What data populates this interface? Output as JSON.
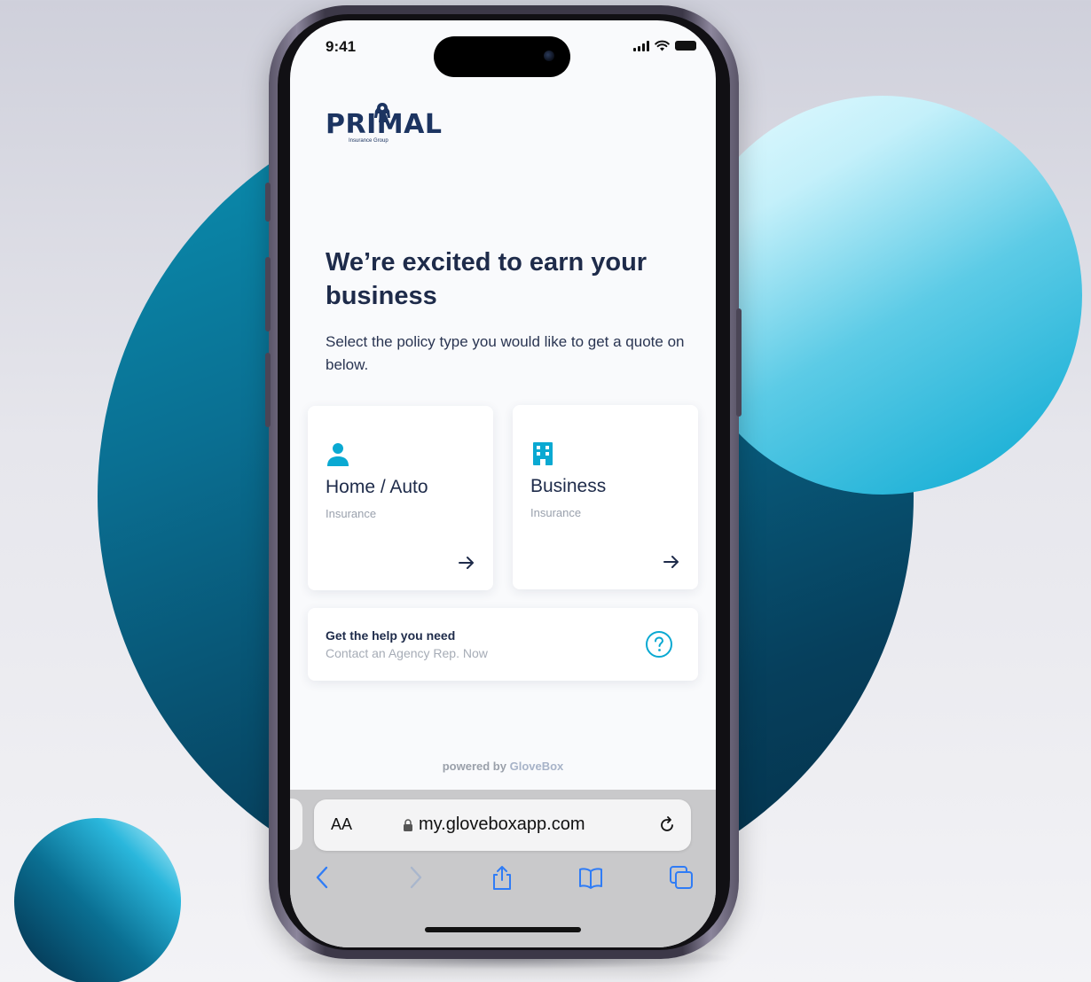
{
  "status": {
    "time": "9:41"
  },
  "logo": {
    "name": "PRIMAL",
    "tagline": "Insurance Group"
  },
  "headline": "We’re excited to earn your business",
  "subtext": "Select the policy type you would like to get a quote on below.",
  "cards": [
    {
      "title": "Home / Auto",
      "subtitle": "Insurance",
      "icon": "person-icon"
    },
    {
      "title": "Business",
      "subtitle": "Insurance",
      "icon": "building-icon"
    }
  ],
  "help": {
    "title": "Get the help you need",
    "subtitle": "Contact an Agency Rep. Now",
    "icon": "question-circle-icon"
  },
  "footer": {
    "powered_prefix": "powered by",
    "brand": "GloveBox"
  },
  "browser": {
    "text_size_label": "AA",
    "url": "my.gloveboxapp.com",
    "toolbar_icons": [
      "back-icon",
      "forward-icon",
      "share-icon",
      "bookmarks-icon",
      "tabs-icon"
    ]
  },
  "colors": {
    "accent": "#0aa9d2",
    "navy": "#1c3461",
    "ios_blue": "#2f7cf6"
  }
}
